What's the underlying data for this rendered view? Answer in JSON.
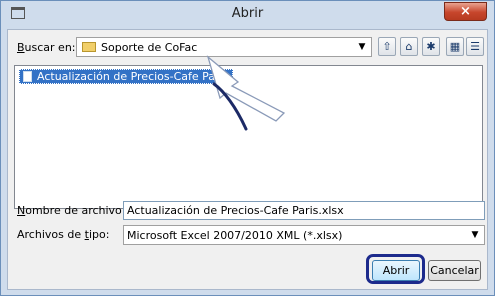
{
  "window": {
    "title": "Abrir",
    "close_glyph": "×"
  },
  "lookin": {
    "label_pre": "",
    "label_u": "B",
    "label_post": "uscar en:",
    "value": "Soporte de CoFac"
  },
  "toolbar": {
    "icons": [
      "up-folder-icon",
      "desktop-icon",
      "new-folder-icon",
      "list-view-icon",
      "details-view-icon"
    ]
  },
  "files": [
    {
      "name": "Actualización de Precios-Cafe Paris.xlsx",
      "selected": true
    }
  ],
  "filename": {
    "label_u": "N",
    "label_post": "ombre de archivo:",
    "value": "Actualización de Precios-Cafe Paris.xlsx"
  },
  "filetype": {
    "label_pre": "Archivos de ",
    "label_u": "t",
    "label_post": "ipo:",
    "value": "Microsoft Excel 2007/2010 XML (*.xlsx)"
  },
  "buttons": {
    "open": "Abrir",
    "cancel": "Cancelar"
  },
  "colors": {
    "selection": "#3372c6",
    "highlight_ring": "#1c2a8c",
    "close": "#c7462c"
  }
}
